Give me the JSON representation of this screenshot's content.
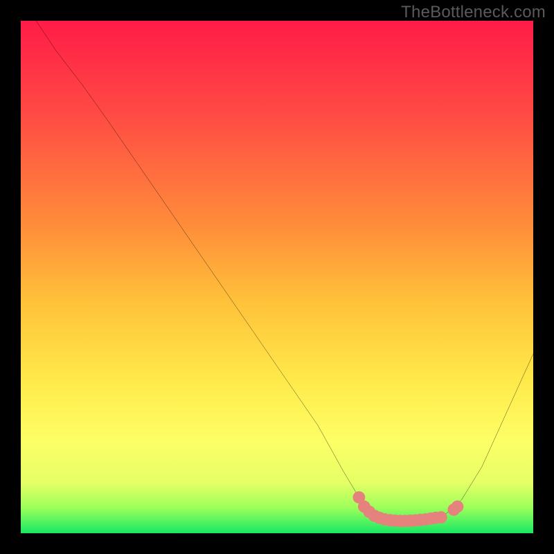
{
  "watermark": "TheBottleneck.com",
  "chart_data": {
    "type": "line",
    "title": "",
    "xlabel": "",
    "ylabel": "",
    "xlim": [
      0,
      100
    ],
    "ylim": [
      0,
      100
    ],
    "gradient_stops": [
      {
        "offset": 0,
        "color": "#ff1c47"
      },
      {
        "offset": 18,
        "color": "#ff4a44"
      },
      {
        "offset": 40,
        "color": "#ff8d3a"
      },
      {
        "offset": 55,
        "color": "#ffc23a"
      },
      {
        "offset": 70,
        "color": "#ffe94a"
      },
      {
        "offset": 82,
        "color": "#fdff66"
      },
      {
        "offset": 90,
        "color": "#e6ff66"
      },
      {
        "offset": 95,
        "color": "#9dff5a"
      },
      {
        "offset": 100,
        "color": "#17e865"
      }
    ],
    "series": [
      {
        "name": "curve",
        "color": "#000000",
        "points": [
          {
            "x": 3,
            "y": 100
          },
          {
            "x": 7,
            "y": 94
          },
          {
            "x": 12,
            "y": 87.5
          },
          {
            "x": 17,
            "y": 80.5
          },
          {
            "x": 58,
            "y": 21
          },
          {
            "x": 63,
            "y": 12
          },
          {
            "x": 66,
            "y": 7
          },
          {
            "x": 68,
            "y": 4.5
          },
          {
            "x": 70,
            "y": 3.2
          },
          {
            "x": 72,
            "y": 2.6
          },
          {
            "x": 75,
            "y": 2.4
          },
          {
            "x": 78,
            "y": 2.5
          },
          {
            "x": 81,
            "y": 3.0
          },
          {
            "x": 83,
            "y": 3.8
          },
          {
            "x": 86,
            "y": 6.5
          },
          {
            "x": 90,
            "y": 13
          },
          {
            "x": 95,
            "y": 24
          },
          {
            "x": 100,
            "y": 35
          }
        ]
      }
    ],
    "highlight": {
      "color": "#e6827e",
      "dot_radius": 1.2,
      "points": [
        {
          "x": 66,
          "y": 7
        },
        {
          "x": 67,
          "y": 5.2
        },
        {
          "x": 68,
          "y": 4.2
        },
        {
          "x": 69,
          "y": 3.4
        },
        {
          "x": 70,
          "y": 3.0
        },
        {
          "x": 71,
          "y": 2.7
        },
        {
          "x": 72,
          "y": 2.55
        },
        {
          "x": 73,
          "y": 2.45
        },
        {
          "x": 74,
          "y": 2.4
        },
        {
          "x": 75,
          "y": 2.4
        },
        {
          "x": 76,
          "y": 2.45
        },
        {
          "x": 77,
          "y": 2.5
        },
        {
          "x": 78,
          "y": 2.6
        },
        {
          "x": 79,
          "y": 2.7
        },
        {
          "x": 80,
          "y": 2.85
        },
        {
          "x": 81,
          "y": 3.0
        },
        {
          "x": 82.0,
          "y": 3.1
        },
        {
          "x": 84.5,
          "y": 4.6
        },
        {
          "x": 85.2,
          "y": 5.2
        }
      ]
    }
  }
}
